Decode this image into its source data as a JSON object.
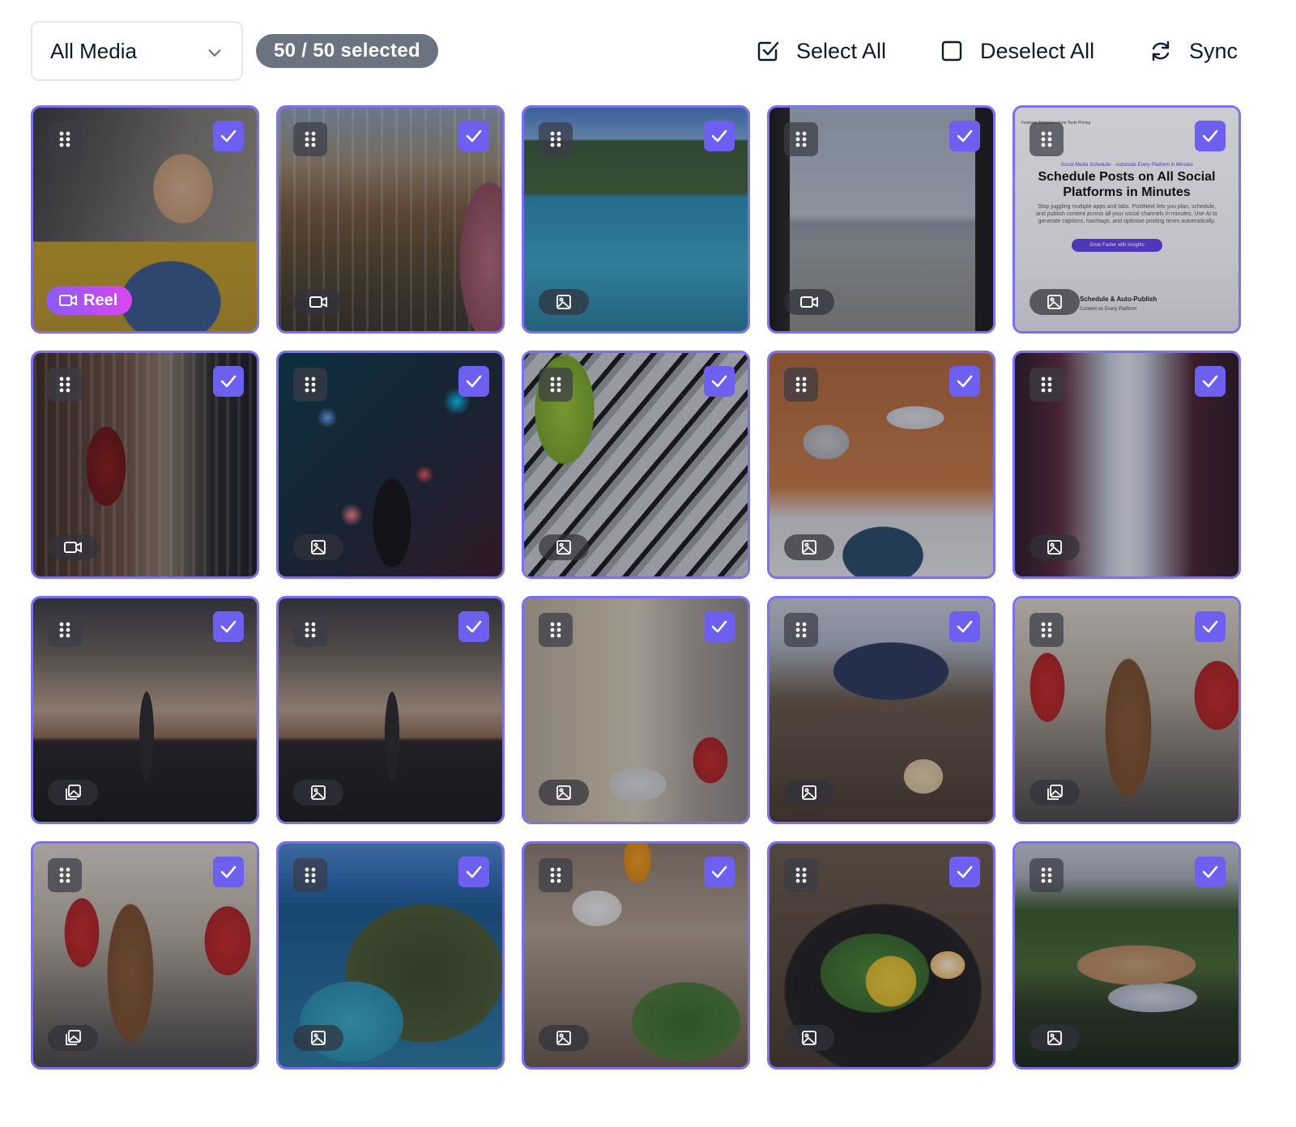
{
  "toolbar": {
    "filter_value": "All Media",
    "selected_badge": "50 / 50 selected",
    "select_all_label": "Select All",
    "deselect_all_label": "Deselect All",
    "sync_label": "Sync"
  },
  "colors": {
    "accent": "#6d5ff0",
    "tile_border": "#7c6ff0",
    "badge_bg": "#6b7280",
    "reel_gradient_start": "#8b5cf6",
    "reel_gradient_end": "#d946ef"
  },
  "grid": {
    "tiles": [
      {
        "subject": "woman relaxing at laptop",
        "media_type": "video",
        "selected": true,
        "badge": "Reel"
      },
      {
        "subject": "train station interior",
        "media_type": "video",
        "selected": true
      },
      {
        "subject": "hotel swimming pool",
        "media_type": "image",
        "selected": true
      },
      {
        "subject": "sea view through window",
        "media_type": "video",
        "selected": true
      },
      {
        "subject": "app landing page screenshot",
        "media_type": "image",
        "selected": true,
        "screenshot_text": {
          "nav": "Features   Templates   Free Tools   Pricing",
          "tagline": "Social Media Scheduler · Automate Every Platform in Minutes",
          "title": "Schedule Posts on All Social Platforms in Minutes",
          "body": "Stop juggling multiple apps and tabs. PostNext lets you plan, schedule, and publish content across all your social channels in minutes. Use AI to generate captions, hashtags, and optimise posting times automatically.",
          "cta": "Grow Faster with Insights",
          "footer_title": "Schedule & Auto-Publish",
          "footer_sub": "Content on Every Platform"
        }
      },
      {
        "subject": "shop window with guard figure",
        "media_type": "video",
        "selected": true
      },
      {
        "subject": "phone in neon bokeh city",
        "media_type": "image",
        "selected": true
      },
      {
        "subject": "stack of plastic suitcases",
        "media_type": "image",
        "selected": true
      },
      {
        "subject": "desk from above with laptop",
        "media_type": "image",
        "selected": true
      },
      {
        "subject": "times square street",
        "media_type": "image",
        "selected": true
      },
      {
        "subject": "big ben at dusk",
        "media_type": "gallery",
        "selected": true
      },
      {
        "subject": "big ben at dusk",
        "media_type": "image",
        "selected": true
      },
      {
        "subject": "london street with flags",
        "media_type": "image",
        "selected": true
      },
      {
        "subject": "laptop and coffee on desk",
        "media_type": "image",
        "selected": true
      },
      {
        "subject": "man in coat on london street",
        "media_type": "gallery",
        "selected": true
      },
      {
        "subject": "man in coat on london street",
        "media_type": "gallery",
        "selected": true
      },
      {
        "subject": "island coastline aerial",
        "media_type": "image",
        "selected": true
      },
      {
        "subject": "coffee and salad on table",
        "media_type": "image",
        "selected": true
      },
      {
        "subject": "breakfast plate with eggs",
        "media_type": "image",
        "selected": true
      },
      {
        "subject": "harbor village on hillside",
        "media_type": "image",
        "selected": true
      }
    ]
  }
}
